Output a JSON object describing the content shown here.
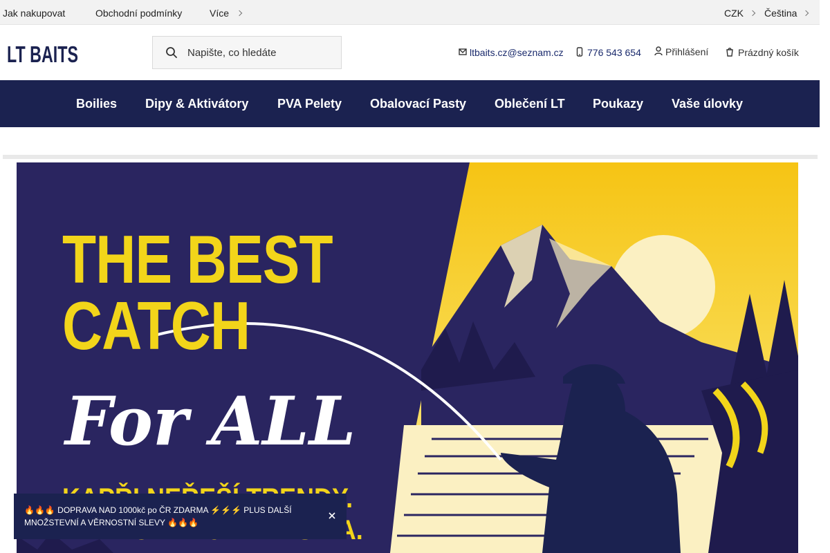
{
  "topbar": {
    "links": [
      "Jak nakupovat",
      "Obchodní podmínky",
      "Více"
    ],
    "currency": "CZK",
    "language": "Čeština"
  },
  "header": {
    "logo_text": "LT BAITS",
    "search_placeholder": "Napište, co hledáte",
    "email": "ltbaits.cz@seznam.cz",
    "phone": "776 543 654",
    "login": "Přihlášení",
    "cart": "Prázdný košík"
  },
  "nav": {
    "items": [
      "Boilies",
      "Dipy & Aktivátory",
      "PVA Pelety",
      "Obalovací Pasty",
      "Oblečení LT",
      "Poukazy",
      "Vaše úlovky"
    ]
  },
  "banner": {
    "headline_line1": "THE BEST",
    "headline_line2": "CATCH",
    "script": "For ALL",
    "tagline1": "KAPŘI NEŘEŠÍ TRENDY.",
    "tagline2": "ALL TOHLE JE KLASIKA."
  },
  "notice": {
    "text": "🔥🔥🔥 DOPRAVA NAD 1000kč po ČR ZDARMA ⚡⚡⚡ PLUS DALŠÍ MNOŽSTEVNÍ A VĚRNOSTNÍ SLEVY 🔥🔥🔥"
  },
  "colors": {
    "navy": "#1b2250",
    "yellow": "#f2d51a",
    "topbar": "#f2f2f2"
  }
}
